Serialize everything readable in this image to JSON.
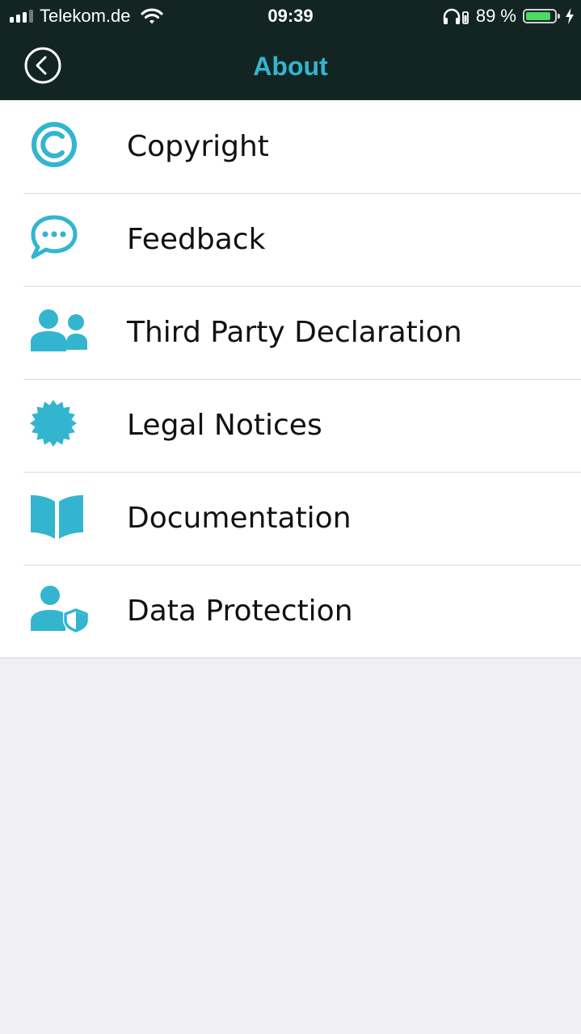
{
  "status_bar": {
    "carrier": "Telekom.de",
    "time": "09:39",
    "battery_percent_label": "89 %",
    "battery_level": 0.89,
    "icons": [
      "signal-icon",
      "wifi-icon",
      "headphones-icon",
      "battery-icon",
      "charging-bolt-icon"
    ]
  },
  "nav": {
    "title": "About",
    "back_icon": "back-chevron-circle-icon"
  },
  "menu": {
    "items": [
      {
        "label": "Copyright",
        "icon": "copyright-icon"
      },
      {
        "label": "Feedback",
        "icon": "chat-bubble-icon"
      },
      {
        "label": "Third Party Declaration",
        "icon": "people-icon"
      },
      {
        "label": "Legal Notices",
        "icon": "seal-badge-icon"
      },
      {
        "label": "Documentation",
        "icon": "open-book-icon"
      },
      {
        "label": "Data Protection",
        "icon": "user-shield-icon"
      }
    ]
  },
  "colors": {
    "accent": "#33b5cf",
    "header_background": "#132522",
    "page_background": "#efeff4",
    "battery_fill": "#4cd964"
  }
}
